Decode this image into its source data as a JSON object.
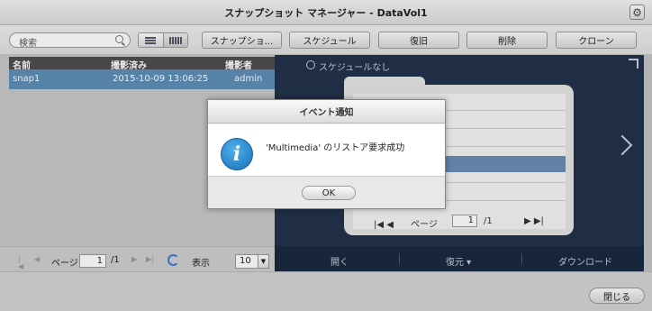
{
  "window": {
    "title": "スナップショット マネージャー - DataVol1",
    "settings_icon": "gear-icon"
  },
  "toolbar": {
    "search_placeholder": "検索",
    "view_list_icon": "list-view-icon",
    "view_grid_icon": "grid-view-icon",
    "buttons": [
      "スナップショ...",
      "スケジュール",
      "復旧",
      "削除",
      "クローン"
    ]
  },
  "table": {
    "columns": [
      "名前",
      "撮影済み",
      "撮影者"
    ],
    "rows": [
      {
        "name": "snap1",
        "taken": "2015-10-09 13:06:25",
        "by": "admin"
      }
    ]
  },
  "pager": {
    "page_label": "ページ",
    "page_value": "1",
    "total": "/1",
    "show_label": "表示",
    "per_page": "10"
  },
  "preview": {
    "schedule_text": "スケジュールなし",
    "pager_label": "ページ",
    "page_value": "1",
    "total": "/1",
    "actions": [
      "開く",
      "復元 ▾",
      "ダウンロード"
    ]
  },
  "footer": {
    "close_label": "閉じる"
  },
  "dialog": {
    "title": "イベント通知",
    "message": "'Multimedia' のリストア要求成功",
    "ok_label": "OK",
    "icon": "info-icon"
  },
  "colors": {
    "selection": "#5f8fb8",
    "preview_bg": "#22324a",
    "info_blue": "#1a6fb8"
  }
}
